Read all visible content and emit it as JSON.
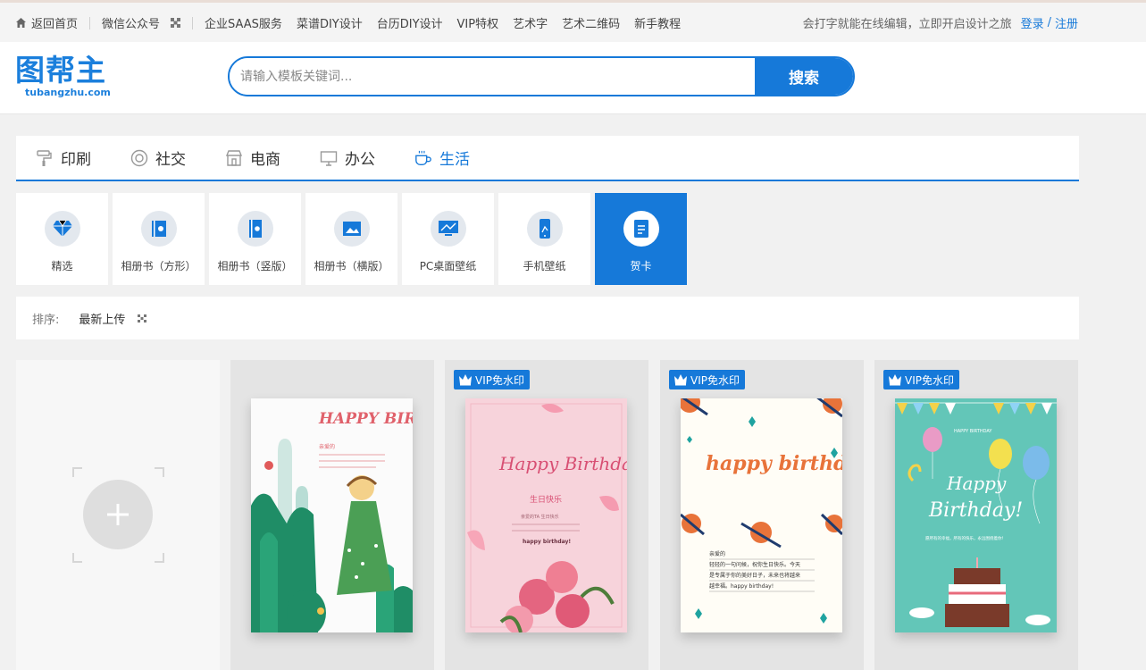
{
  "topbar": {
    "home": "返回首页",
    "wechat": "微信公众号",
    "nav": [
      "企业SAAS服务",
      "菜谱DIY设计",
      "台历DIY设计",
      "VIP特权",
      "艺术字",
      "艺术二维码",
      "新手教程"
    ],
    "slogan": "会打字就能在线编辑，立即开启设计之旅",
    "login": "登录",
    "slash": "/",
    "register": "注册"
  },
  "logo": {
    "main": "图帮主",
    "sub": "tubangzhu.com"
  },
  "search": {
    "placeholder": "请输入模板关键词...",
    "value": "",
    "button": "搜索"
  },
  "categories": [
    {
      "label": "印刷",
      "icon": "paint-roller-icon"
    },
    {
      "label": "社交",
      "icon": "social-circle-icon"
    },
    {
      "label": "电商",
      "icon": "shop-icon"
    },
    {
      "label": "办公",
      "icon": "monitor-icon"
    },
    {
      "label": "生活",
      "icon": "coffee-cup-icon",
      "active": true
    }
  ],
  "subcategories": [
    {
      "label": "精选",
      "icon": "diamond-icon"
    },
    {
      "label": "相册书（方形）",
      "icon": "album-square-icon"
    },
    {
      "label": "相册书（竖版）",
      "icon": "album-portrait-icon"
    },
    {
      "label": "相册书（横版）",
      "icon": "album-landscape-icon"
    },
    {
      "label": "PC桌面壁纸",
      "icon": "desktop-wallpaper-icon"
    },
    {
      "label": "手机壁纸",
      "icon": "phone-wallpaper-icon"
    },
    {
      "label": "贺卡",
      "icon": "greeting-card-icon",
      "active": true
    }
  ],
  "sort": {
    "label": "排序:",
    "value": "最新上传"
  },
  "cards": {
    "vip_badge": "VIP免水印",
    "card1": {
      "title": "HAPPY BIRTHDAY",
      "line": "亲爱的"
    },
    "card2": {
      "title": "Happy Birthday",
      "subtitle": "生日快乐",
      "line1": "亲爱的TA 生日快乐",
      "wish": "happy birthday!"
    },
    "card3": {
      "title": "happy birthday",
      "greeting": "亲爱的",
      "line1": "轻轻的一句问候，祝你生日快乐。今天",
      "line2": "是专属于你的美好日子，未来也将越来",
      "line3": "越幸福。happy birthday!"
    },
    "card4": {
      "top": "HAPPY BIRTHDAY",
      "title1": "Happy",
      "title2": "Birthday!",
      "line": "愿所有的幸福，所有的快乐，永远围绕着你！"
    }
  },
  "colors": {
    "accent": "#1679d9",
    "page_bg": "#f1f1f1"
  }
}
